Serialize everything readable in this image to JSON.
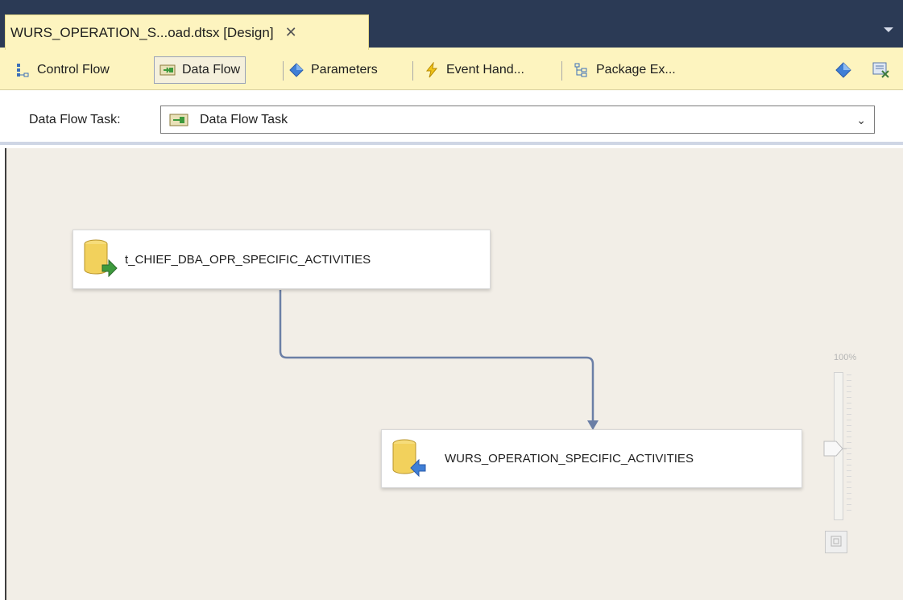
{
  "document_tab": {
    "title": "WURS_OPERATION_S...oad.dtsx [Design]",
    "close_glyph": "✕"
  },
  "designer_tabs": [
    {
      "label": "Control Flow",
      "icon": "control-flow-icon",
      "active": false
    },
    {
      "label": "Data Flow",
      "icon": "data-flow-icon",
      "active": true
    },
    {
      "label": "Parameters",
      "icon": "parameters-icon",
      "active": false
    },
    {
      "label": "Event Hand...",
      "icon": "event-handlers-icon",
      "active": false
    },
    {
      "label": "Package Ex...",
      "icon": "package-explorer-icon",
      "active": false
    }
  ],
  "toolbar_icons": [
    "parameters-diamond-icon",
    "package-settings-icon"
  ],
  "task_selector": {
    "label": "Data Flow Task:",
    "value": "Data Flow Task",
    "chevron_glyph": "⌄"
  },
  "components": {
    "source": {
      "name": "t_CHIEF_DBA_OPR_SPECIFIC_ACTIVITIES",
      "type": "source"
    },
    "destination": {
      "name": "WURS_OPERATION_SPECIFIC_ACTIVITIES",
      "type": "destination"
    }
  },
  "zoom": {
    "label": "100%",
    "level": 1.0
  },
  "colors": {
    "tab_bg": "#fdf4bf",
    "header_dark": "#2b3a55",
    "canvas_bg": "#f2eee7",
    "connector": "#6b7fa6",
    "source_arrow": "#3d9a3d",
    "destination_arrow": "#3f7fd6",
    "db_fill": "#f2d15c"
  }
}
